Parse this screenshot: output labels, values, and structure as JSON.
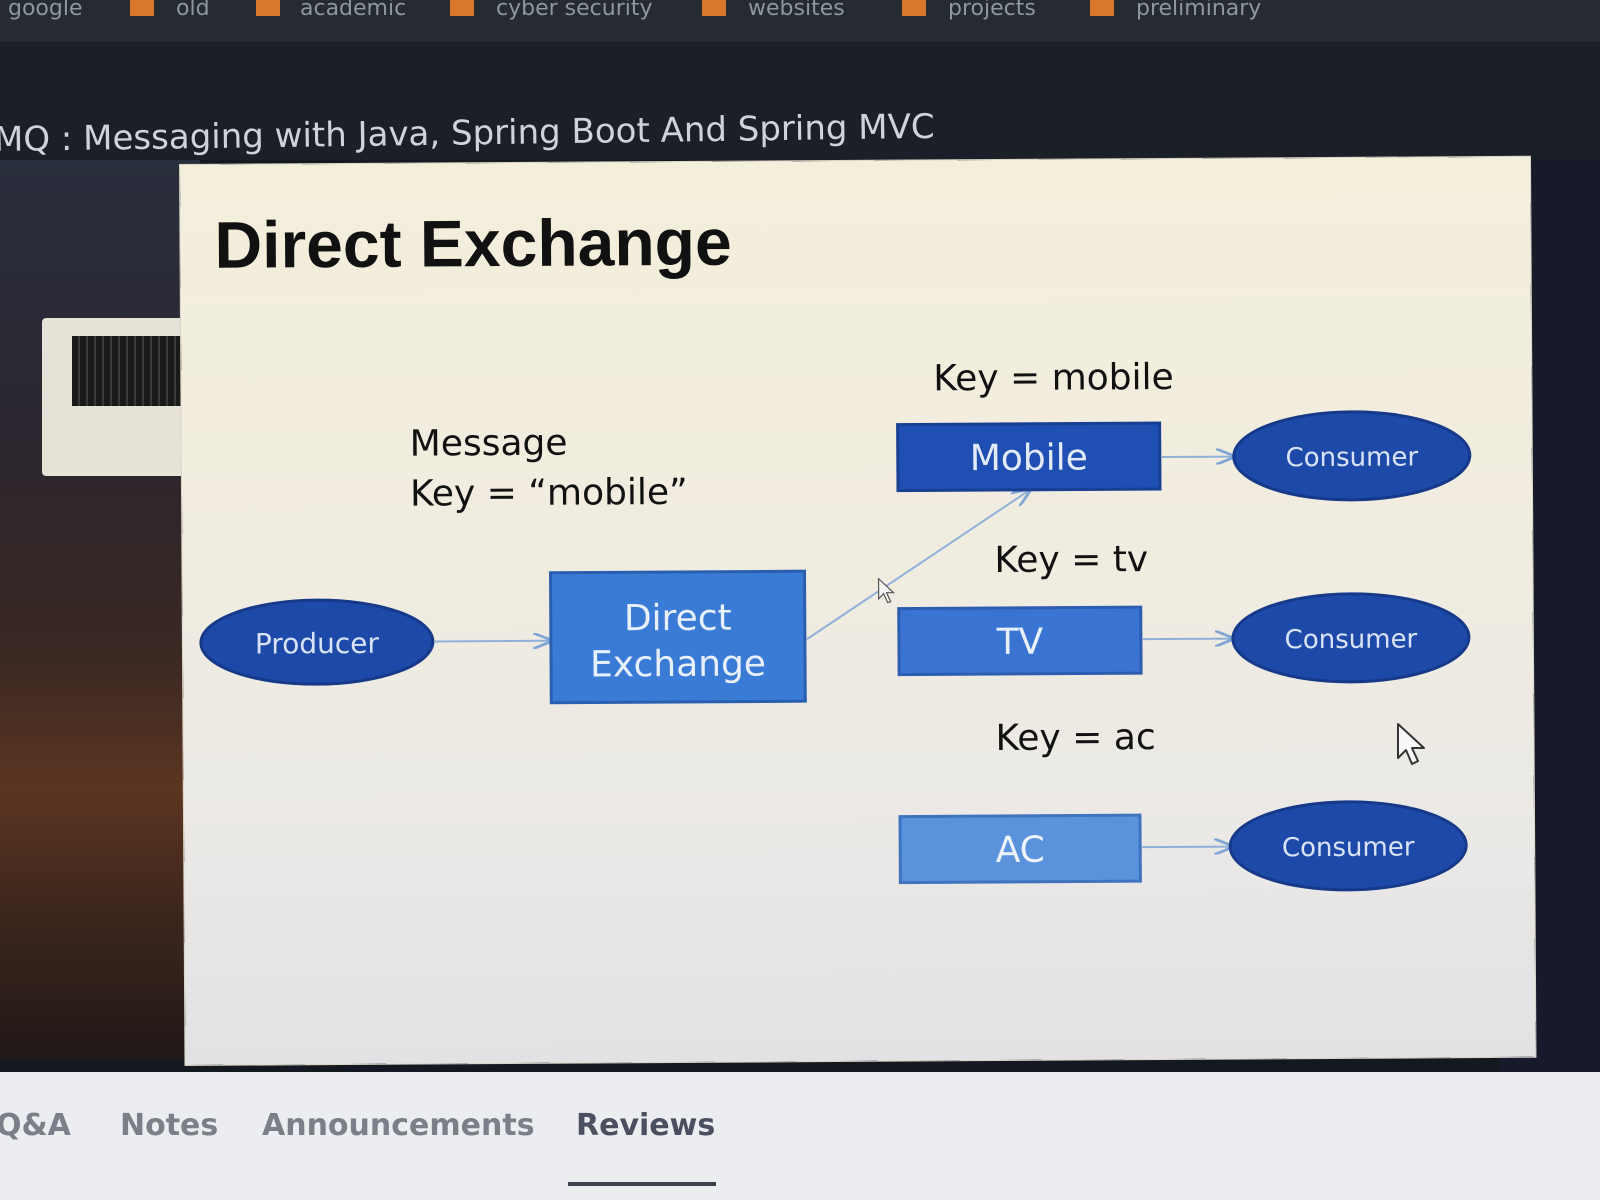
{
  "bookmarks": [
    {
      "label": "google",
      "folder": false
    },
    {
      "label": "old",
      "folder": true
    },
    {
      "label": "academic",
      "folder": true
    },
    {
      "label": "cyber security",
      "folder": true
    },
    {
      "label": "websites",
      "folder": true
    },
    {
      "label": "projects",
      "folder": true
    },
    {
      "label": "preliminary",
      "folder": true
    }
  ],
  "course": {
    "title": "MQ : Messaging with Java, Spring Boot And Spring MVC"
  },
  "slide": {
    "title": "Direct Exchange",
    "message_label": "Message",
    "message_key": "Key = “mobile”",
    "producer": "Producer",
    "exchange_line1": "Direct",
    "exchange_line2": "Exchange",
    "queues": [
      {
        "name": "Mobile",
        "binding": "Key = mobile",
        "consumer": "Consumer",
        "color": "#1f4fb2"
      },
      {
        "name": "TV",
        "binding": "Key = tv",
        "consumer": "Consumer",
        "color": "#3a74d2"
      },
      {
        "name": "AC",
        "binding": "Key = ac",
        "consumer": "Consumer",
        "color": "#5a92db"
      }
    ]
  },
  "tabs": [
    {
      "label": "Q&A",
      "active": false
    },
    {
      "label": "Notes",
      "active": false
    },
    {
      "label": "Announcements",
      "active": false
    },
    {
      "label": "Reviews",
      "active": true
    }
  ],
  "colors": {
    "ellipse": "#1d4aa8",
    "exchange_box": "#3a7bd5",
    "title_text": "#111111"
  }
}
